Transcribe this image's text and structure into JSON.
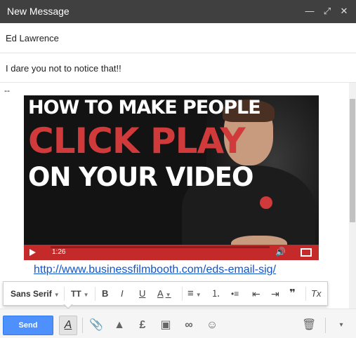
{
  "window": {
    "title": "New Message",
    "minimize_icon": "minimize-icon",
    "expand_icon": "expand-icon",
    "close_icon": "close-icon"
  },
  "recipients": {
    "to_value": "Ed Lawrence"
  },
  "subject": {
    "value": "I dare you not to notice that!!"
  },
  "body": {
    "signature_dash": "--",
    "video": {
      "line1": "HOW TO MAKE PEOPLE",
      "line2": "CLICK PLAY",
      "line3": "ON YOUR VIDEO",
      "time": "1:26",
      "accent_color": "#c42a2a"
    },
    "link": "http://www.businessfilmbooth.com/eds-email-sig/"
  },
  "format_toolbar": {
    "font": "Sans Serif",
    "items": [
      "font-size-icon",
      "bold-icon",
      "italic-icon",
      "underline-icon",
      "text-color-icon",
      "align-icon",
      "numbered-list-icon",
      "bulleted-list-icon",
      "indent-less-icon",
      "indent-more-icon",
      "quote-icon",
      "remove-formatting-icon"
    ],
    "glyphs": {
      "size": "TT",
      "bold": "B",
      "italic": "I",
      "underline": "U",
      "color": "A",
      "align": "≡",
      "numbered": "⒈",
      "bulleted": "•≡",
      "indent_less": "⇤",
      "indent_more": "⇥",
      "quote": "❞",
      "clear": "Tx"
    }
  },
  "bottom_bar": {
    "send_label": "Send",
    "send_color": "#4d90fe",
    "format_glyph": "A",
    "attach_glyph": "📎",
    "drive_glyph": "▲",
    "money_glyph": "£",
    "photo_glyph": "▣",
    "link_glyph": "∞",
    "emoji_glyph": "☺",
    "trash_glyph": "🗑",
    "more_glyph": "▾"
  }
}
